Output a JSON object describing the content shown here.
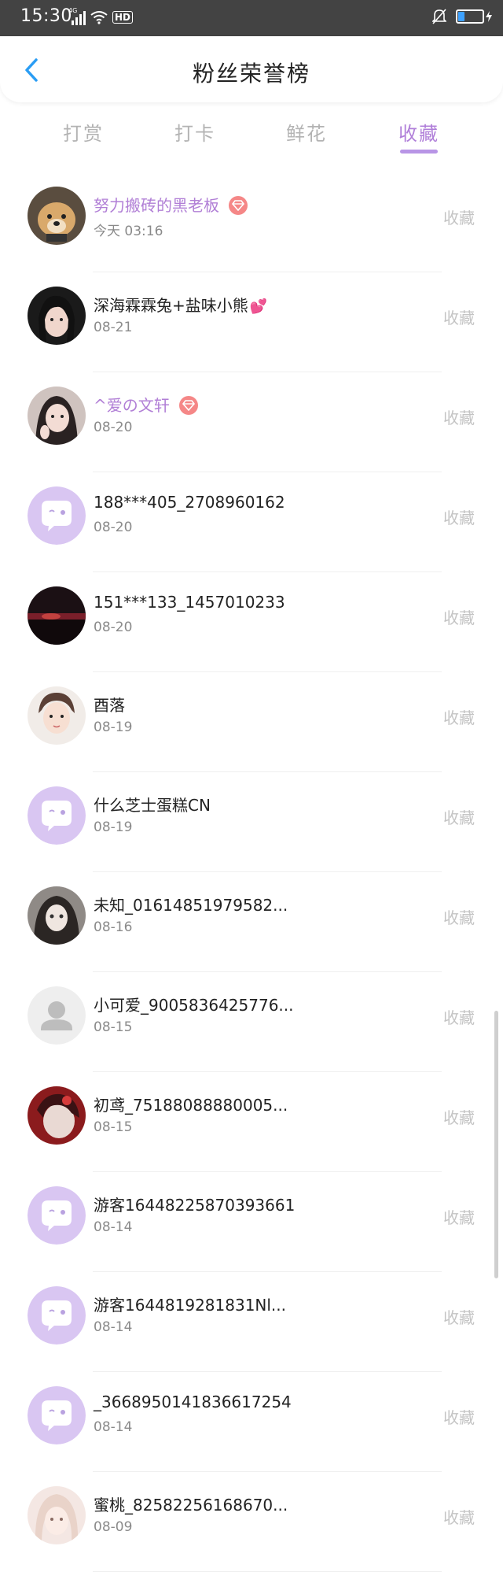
{
  "status": {
    "time": "15:30",
    "network": "4G",
    "hd": "HD"
  },
  "header": {
    "title": "粉丝荣誉榜"
  },
  "tabs": [
    {
      "label": "打赏"
    },
    {
      "label": "打卡"
    },
    {
      "label": "鲜花"
    },
    {
      "label": "收藏",
      "active": true
    }
  ],
  "fans": [
    {
      "name": "努力搬砖的黑老板",
      "date": "今天 03:16",
      "action": "收藏",
      "avatar": "dog"
    },
    {
      "name": "深海霖霖兔+盐味小熊",
      "date": "08-21",
      "action": "收藏",
      "avatar": "girl-dark"
    },
    {
      "name": "^爱の文轩",
      "date": "08-20",
      "action": "收藏",
      "avatar": "girl-peace"
    },
    {
      "name": "188***405_2708960162",
      "date": "08-20",
      "action": "收藏",
      "avatar": "default-chat"
    },
    {
      "name": "151***133_1457010233",
      "date": "08-20",
      "action": "收藏",
      "avatar": "sunset"
    },
    {
      "name": "酉落",
      "date": "08-19",
      "action": "收藏",
      "avatar": "boy"
    },
    {
      "name": "什么芝士蛋糕CN",
      "date": "08-19",
      "action": "收藏",
      "avatar": "default-chat"
    },
    {
      "name": "未知_01614851979582...",
      "date": "08-16",
      "action": "收藏",
      "avatar": "anime"
    },
    {
      "name": "小可爱_9005836425776...",
      "date": "08-15",
      "action": "收藏",
      "avatar": "default-person"
    },
    {
      "name": "初鸢_75188088880005...",
      "date": "08-15",
      "action": "收藏",
      "avatar": "red"
    },
    {
      "name": "游客16448225870393661",
      "date": "08-14",
      "action": "收藏",
      "avatar": "default-chat"
    },
    {
      "name": "游客1644819281831Nl...",
      "date": "08-14",
      "action": "收藏",
      "avatar": "default-chat"
    },
    {
      "name": "_3668950141836617254",
      "date": "08-14",
      "action": "收藏",
      "avatar": "default-chat"
    },
    {
      "name": "蜜桃_82582256168670...",
      "date": "08-09",
      "action": "收藏",
      "avatar": "peach"
    }
  ],
  "colors": {
    "accent": "#b07fd9",
    "vip_name": "#b17fd6",
    "badge": "#f58787",
    "back": "#2a9df4"
  }
}
